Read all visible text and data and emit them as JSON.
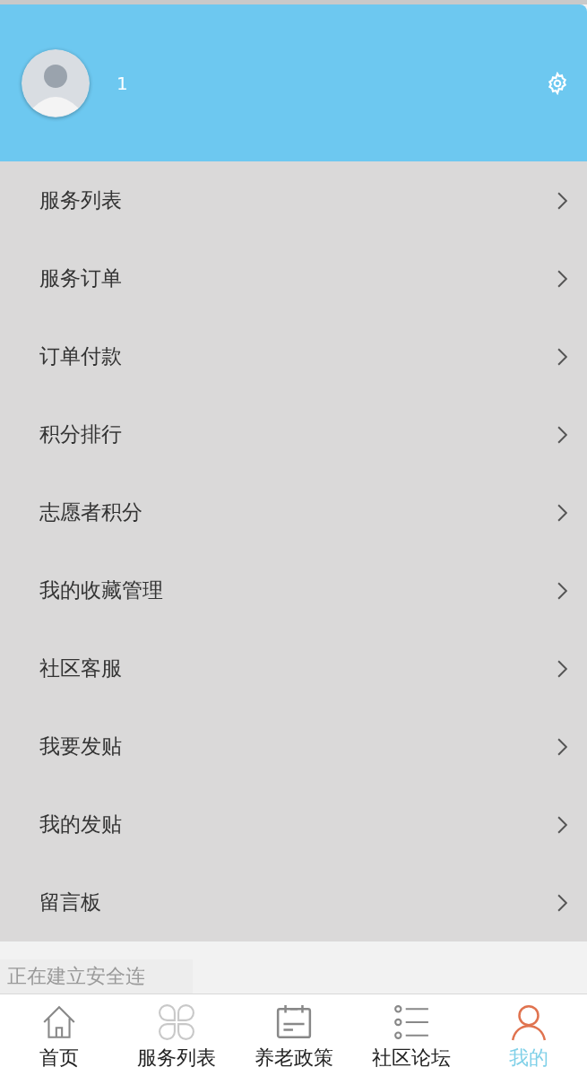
{
  "profile": {
    "name": "1"
  },
  "menu": [
    {
      "label": "服务列表"
    },
    {
      "label": "服务订单"
    },
    {
      "label": "订单付款"
    },
    {
      "label": "积分排行"
    },
    {
      "label": "志愿者积分"
    },
    {
      "label": "我的收藏管理"
    },
    {
      "label": "社区客服"
    },
    {
      "label": "我要发贴"
    },
    {
      "label": "我的发贴"
    },
    {
      "label": "留言板"
    }
  ],
  "tabbar": [
    {
      "label": "首页",
      "kind": "home",
      "selected": false
    },
    {
      "label": "服务列表",
      "kind": "grid",
      "selected": false
    },
    {
      "label": "养老政策",
      "kind": "calendar",
      "selected": false
    },
    {
      "label": "社区论坛",
      "kind": "list",
      "selected": false
    },
    {
      "label": "我的",
      "kind": "person",
      "selected": true
    }
  ],
  "status_overlay": {
    "text": "正在建立安全连"
  }
}
